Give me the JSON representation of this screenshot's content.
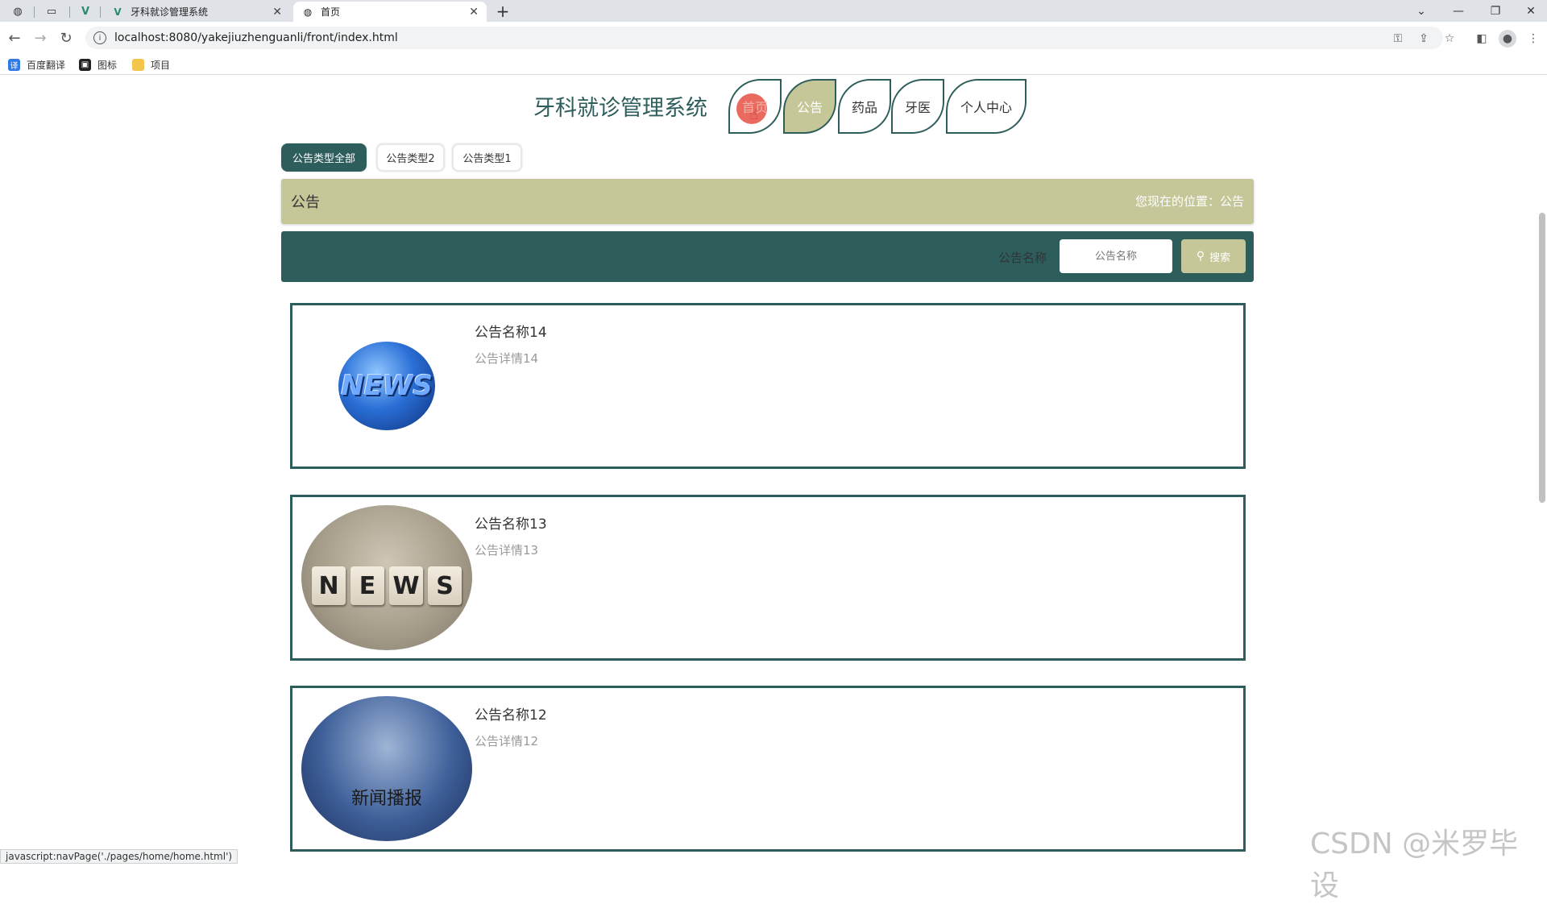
{
  "browser": {
    "tabs": [
      {
        "title": "牙科就诊管理系统",
        "active": false
      },
      {
        "title": "首页",
        "active": true
      }
    ],
    "new_tab": "+",
    "url": "localhost:8080/yakejiuzhenguanli/front/index.html",
    "bookmarks": [
      {
        "label": "百度翻译",
        "icon": "translate-icon"
      },
      {
        "label": "图标",
        "icon": "image-icon"
      },
      {
        "label": "项目",
        "icon": "folder-icon"
      }
    ]
  },
  "site": {
    "title": "牙科就诊管理系统",
    "nav": [
      {
        "label": "首页"
      },
      {
        "label": "公告"
      },
      {
        "label": "药品"
      },
      {
        "label": "牙医"
      },
      {
        "label": "个人中心"
      }
    ]
  },
  "filters": {
    "types": [
      "公告类型全部",
      "公告类型2",
      "公告类型1"
    ]
  },
  "breadcrumb": {
    "title": "公告",
    "location": "您现在的位置：公告"
  },
  "search": {
    "label": "公告名称",
    "placeholder": "公告名称",
    "button": "搜索"
  },
  "notices": [
    {
      "title": "公告名称14",
      "detail": "公告详情14",
      "image": "news-globe"
    },
    {
      "title": "公告名称13",
      "detail": "公告详情13",
      "image": "news-cubes",
      "image_text": "NEWS"
    },
    {
      "title": "公告名称12",
      "detail": "公告详情12",
      "image": "news-stage",
      "image_text": "新闻播报"
    }
  ],
  "globe_text": "NEWS",
  "status_text": "javascript:navPage('./pages/home/home.html')",
  "watermark": "CSDN @米罗毕设",
  "colors": {
    "primary": "#2d5e5b",
    "accent": "#c5c798",
    "highlight_dot": "#e85a4f"
  }
}
